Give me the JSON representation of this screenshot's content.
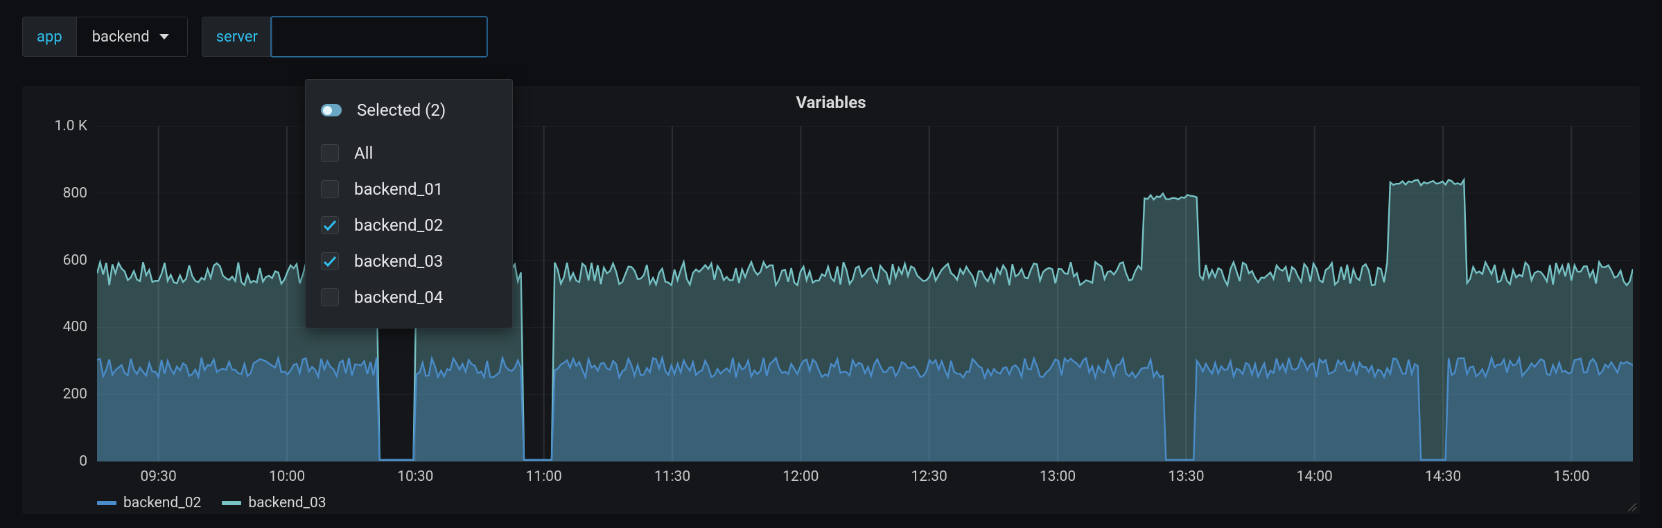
{
  "variables": {
    "app": {
      "label": "app",
      "value": "backend"
    },
    "server": {
      "label": "server",
      "value": ""
    }
  },
  "dropdown": {
    "header": "Selected (2)",
    "all_label": "All",
    "options": [
      {
        "label": "backend_01",
        "checked": false
      },
      {
        "label": "backend_02",
        "checked": true
      },
      {
        "label": "backend_03",
        "checked": true
      },
      {
        "label": "backend_04",
        "checked": false
      }
    ]
  },
  "panel": {
    "title": "Variables"
  },
  "legend": [
    {
      "label": "backend_02",
      "color": "#4a8cc9"
    },
    {
      "label": "backend_03",
      "color": "#76c2c5"
    }
  ],
  "chart_data": {
    "type": "area",
    "title": "Variables",
    "xlabel": "",
    "ylabel": "",
    "ylim": [
      0,
      1000
    ],
    "y_ticks": [
      "0",
      "200",
      "400",
      "600",
      "800",
      "1.0 K"
    ],
    "x_ticks": [
      "09:30",
      "10:00",
      "10:30",
      "11:00",
      "11:30",
      "12:00",
      "12:30",
      "13:00",
      "13:30",
      "14:00",
      "14:30",
      "15:00"
    ],
    "x_range": [
      "09:15",
      "15:20"
    ],
    "series": [
      {
        "name": "backend_02",
        "color": "#4a8cc9",
        "avg": 280,
        "noise": 30,
        "dips": [
          {
            "at": 0.195,
            "w": 0.012
          },
          {
            "at": 0.287,
            "w": 0.01
          },
          {
            "at": 0.705,
            "w": 0.01
          },
          {
            "at": 0.87,
            "w": 0.01
          }
        ]
      },
      {
        "name": "backend_03",
        "color": "#76c2c5",
        "avg": 560,
        "noise": 35,
        "dips": [
          {
            "at": 0.195,
            "w": 0.012
          },
          {
            "at": 0.287,
            "w": 0.01
          },
          {
            "at": 0.705,
            "w": 0.01
          },
          {
            "at": 0.87,
            "w": 0.01
          }
        ],
        "spikes": [
          {
            "at": 0.7,
            "w": 0.018,
            "to": 790
          },
          {
            "at": 0.866,
            "w": 0.025,
            "to": 830
          }
        ]
      }
    ]
  }
}
